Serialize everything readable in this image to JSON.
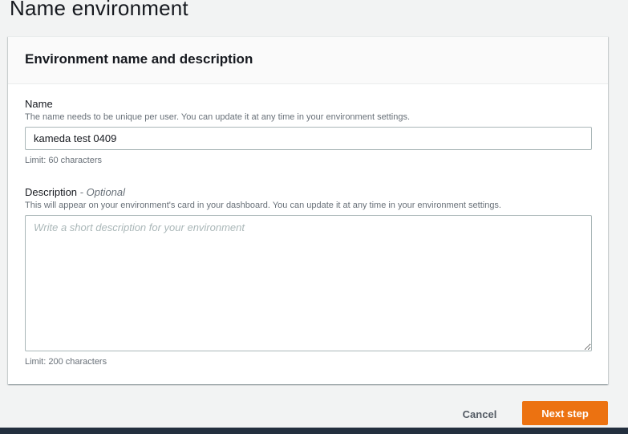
{
  "page": {
    "title": "Name environment"
  },
  "card": {
    "title": "Environment name and description"
  },
  "name_field": {
    "label": "Name",
    "description": "The name needs to be unique per user. You can update it at any time in your environment settings.",
    "value": "kameda test 0409",
    "limit": "Limit: 60 characters"
  },
  "description_field": {
    "label": "Description",
    "optional": "- Optional",
    "description": "This will appear on your environment's card in your dashboard. You can update it at any time in your environment settings.",
    "value": "",
    "placeholder": "Write a short description for your environment",
    "limit": "Limit: 200 characters"
  },
  "actions": {
    "cancel_label": "Cancel",
    "next_label": "Next step"
  },
  "colors": {
    "primary_button": "#ec7211",
    "bottom_bar": "#232f3e"
  }
}
